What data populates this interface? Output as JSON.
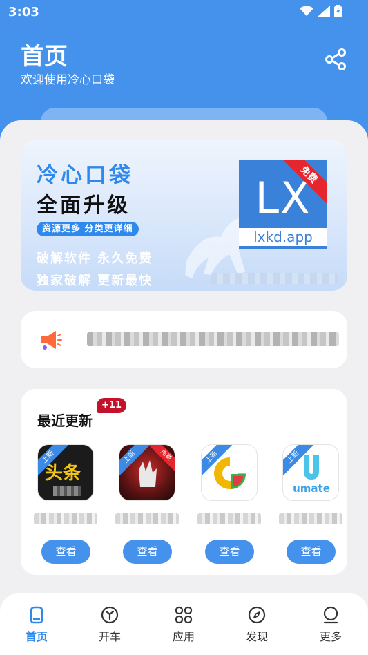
{
  "status_bar": {
    "time": "3:03"
  },
  "header": {
    "title": "首页",
    "subtitle": "欢迎使用冷心口袋",
    "share_icon": "share-icon"
  },
  "banner": {
    "title": "冷心口袋",
    "subtitle": "全面升级",
    "pill": "资源更多 分类更详细",
    "line1": "破解软件 永久免费",
    "line2": "独家破解 更新最快",
    "logo_text": "LX",
    "logo_url": "lxkd.app",
    "logo_ribbon": "免费"
  },
  "notice": {
    "icon": "megaphone-icon"
  },
  "recent": {
    "title": "最近更新",
    "badge": "+11",
    "tag_label": "上新",
    "view_label": "查看",
    "apps": [
      {
        "icon_text": "头条",
        "bg": "#1b1b1b",
        "fg": "#f0c419"
      },
      {
        "icon_text": "免费",
        "bg": "#3a1a1a",
        "fg": "#ff3b3b"
      },
      {
        "icon_text": "",
        "bg": "#ffffff",
        "fg": "#f2b705"
      },
      {
        "icon_text": "umate",
        "bg": "#ffffff",
        "fg": "#3aa3e8"
      }
    ]
  },
  "nav": [
    {
      "label": "首页",
      "icon": "home-icon",
      "active": true
    },
    {
      "label": "开车",
      "icon": "cube-icon",
      "active": false
    },
    {
      "label": "应用",
      "icon": "apps-grid-icon",
      "active": false
    },
    {
      "label": "发现",
      "icon": "compass-icon",
      "active": false
    },
    {
      "label": "更多",
      "icon": "profile-icon",
      "active": false
    }
  ],
  "colors": {
    "primary": "#4592ec",
    "accent_red": "#c4122b",
    "background": "#f0f0f3"
  }
}
